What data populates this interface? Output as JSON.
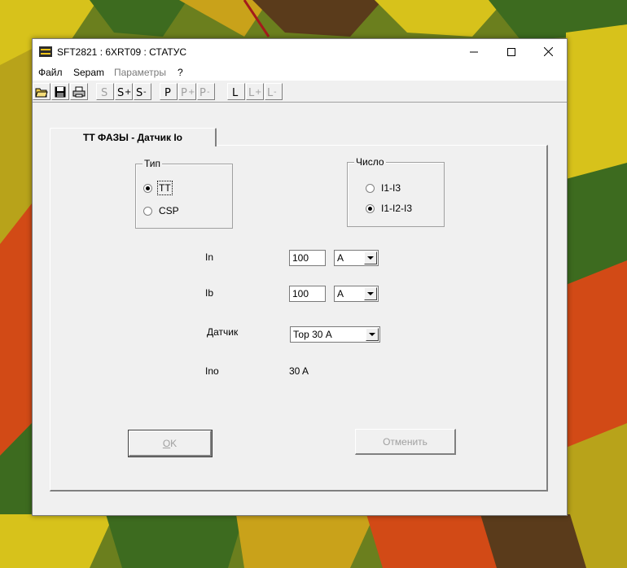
{
  "window": {
    "title": "SFT2821 : 6XRT09 : СТАТУС"
  },
  "menu": {
    "items": [
      {
        "label": "Файл",
        "enabled": true
      },
      {
        "label": "Sepam",
        "enabled": true
      },
      {
        "label": "Параметры",
        "enabled": false
      },
      {
        "label": "?",
        "enabled": true
      }
    ]
  },
  "toolbar": {
    "buttons": [
      {
        "icon": "open-folder-icon",
        "enabled": true
      },
      {
        "icon": "save-disk-icon",
        "enabled": true
      },
      {
        "icon": "printer-icon",
        "enabled": true
      },
      {
        "icon": "s-icon",
        "enabled": false
      },
      {
        "icon": "s-plus-icon",
        "enabled": true
      },
      {
        "icon": "s-minus-icon",
        "enabled": true
      },
      {
        "icon": "p-icon",
        "enabled": true
      },
      {
        "icon": "p-plus-icon",
        "enabled": false
      },
      {
        "icon": "p-minus-icon",
        "enabled": false
      },
      {
        "icon": "l-icon",
        "enabled": true
      },
      {
        "icon": "l-plus-icon",
        "enabled": false
      },
      {
        "icon": "l-minus-icon",
        "enabled": false
      }
    ]
  },
  "tab": {
    "label": "ТТ ФАЗЫ - Датчик Io"
  },
  "type_group": {
    "legend": "Тип",
    "options": [
      {
        "label": "ТТ",
        "checked": true
      },
      {
        "label": "CSP",
        "checked": false
      }
    ]
  },
  "count_group": {
    "legend": "Число",
    "options": [
      {
        "label": "I1-I3",
        "checked": false
      },
      {
        "label": "I1-I2-I3",
        "checked": true
      }
    ]
  },
  "fields": {
    "in_label": "In",
    "in_value": "100",
    "in_unit": "A",
    "ib_label": "Ib",
    "ib_value": "100",
    "ib_unit": "A",
    "sensor_label": "Датчик",
    "sensor_value": "Тор 30 А",
    "ino_label": "Ino",
    "ino_value": "30 A"
  },
  "buttons": {
    "ok_label": "OK",
    "ok_enabled": false,
    "cancel_label": "Отменить",
    "cancel_enabled": false
  },
  "colors": {
    "window_bg": "#f0f0f0",
    "disabled_text": "#a0a0a0",
    "wallpaper_base": "#6b7f1e"
  }
}
